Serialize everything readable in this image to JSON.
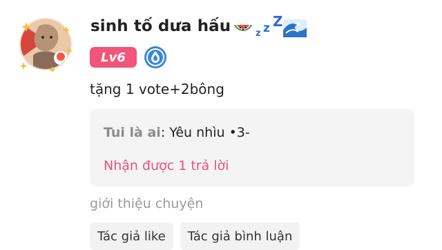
{
  "user": {
    "name": "sinh tố dưa hấu",
    "emoji_suffix_icons": [
      "watermelon-icon",
      "sleeping-zzz-icon",
      "wave-icon"
    ],
    "level_label": "Lv6",
    "level_badge_color": "#f2557a",
    "extra_badge_icon": "water-drop-icon",
    "extra_badge_color": "#3a86d6"
  },
  "comment": {
    "text": "tặng 1 vote+2bông"
  },
  "quote": {
    "author": "Tui là ai",
    "separator": ": ",
    "text": "Yêu nhìu •3-",
    "reply_link": "Nhận được 1 trả lời",
    "accent_color": "#ee4f83"
  },
  "footer": {
    "intro_label": "giới thiệu chuyện",
    "tags": [
      "Tác giả like",
      "Tác giả bình luận"
    ]
  }
}
